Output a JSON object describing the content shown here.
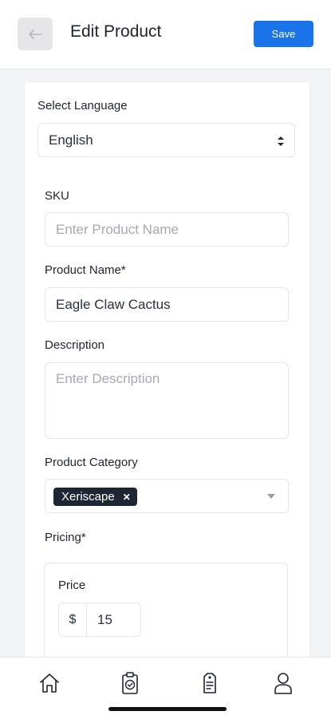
{
  "header": {
    "title": "Edit Product",
    "save_label": "Save"
  },
  "form": {
    "language_label": "Select Language",
    "language_value": "English",
    "sku_label": "SKU",
    "sku_placeholder": "Enter Product Name",
    "name_label": "Product Name*",
    "name_value": "Eagle Claw Cactus",
    "description_label": "Description",
    "description_placeholder": "Enter Description",
    "category_label": "Product Category",
    "category_chip": "Xeriscape",
    "pricing_label": "Pricing*",
    "price_label": "Price",
    "currency_symbol": "$",
    "price_value": "15"
  },
  "nav": {
    "items": [
      {
        "icon": "home-icon"
      },
      {
        "icon": "clipboard-check-icon"
      },
      {
        "icon": "product-tag-icon"
      },
      {
        "icon": "profile-icon"
      }
    ]
  },
  "colors": {
    "accent": "#1a73e8",
    "chip_bg": "#1e2533"
  }
}
